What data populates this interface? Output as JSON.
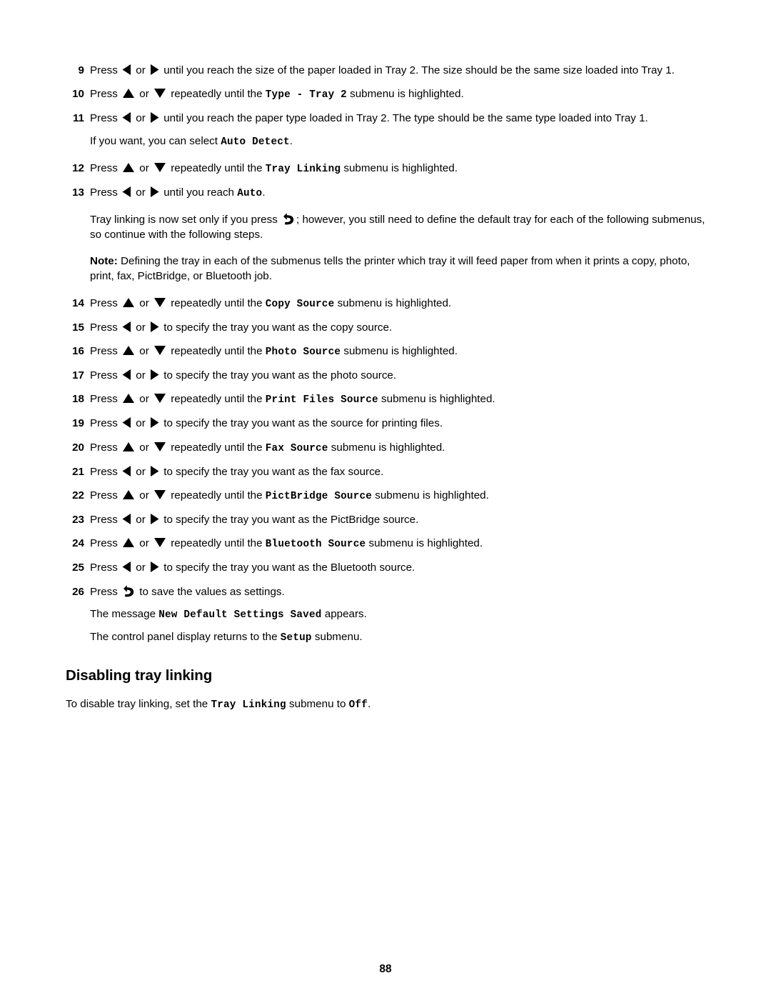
{
  "document": {
    "page_number": "88",
    "heading": "Disabling tray linking",
    "heading_body_before": "To disable tray linking, set the ",
    "heading_body_ui1": "Tray Linking",
    "heading_body_mid": " submenu to ",
    "heading_body_ui2": "Off",
    "heading_body_after": "."
  },
  "icons": {
    "left": "left-arrow-icon",
    "right": "right-arrow-icon",
    "up": "up-arrow-icon",
    "down": "down-arrow-icon",
    "back": "back-arrow-icon",
    "or": " or "
  },
  "steps": [
    {
      "num": "9",
      "p1": "Press ",
      "p2": " until you reach the size of the paper loaded in Tray 2. The size should be the same size loaded into Tray 1."
    },
    {
      "num": "10",
      "p1": "Press ",
      "p2": " repeatedly until the ",
      "ui": "Type - Tray 2",
      "p3": " submenu is highlighted."
    },
    {
      "num": "11",
      "p1": "Press ",
      "p2": " until you reach the paper type loaded in Tray 2. The type should be the same type loaded into Tray 1."
    },
    {
      "num": "12",
      "p1": "Press ",
      "p2": " repeatedly until the ",
      "ui": "Tray Linking",
      "p3": " submenu is highlighted."
    },
    {
      "num": "13",
      "p1": "Press ",
      "p2": " until you reach ",
      "ui": "Auto",
      "p3": "."
    },
    {
      "num": "14",
      "p1": "Press ",
      "p2": " repeatedly until the ",
      "ui": "Copy Source",
      "p3": " submenu is highlighted."
    },
    {
      "num": "15",
      "p1": "Press ",
      "p2": " to specify the tray you want as the copy source."
    },
    {
      "num": "16",
      "p1": "Press ",
      "p2": " repeatedly until the ",
      "ui": "Photo Source",
      "p3": " submenu is highlighted."
    },
    {
      "num": "17",
      "p1": "Press ",
      "p2": " to specify the tray you want as the photo source."
    },
    {
      "num": "18",
      "p1": "Press ",
      "p2": " repeatedly until the ",
      "ui": "Print Files Source",
      "p3": " submenu is highlighted."
    },
    {
      "num": "19",
      "p1": "Press ",
      "p2": " to specify the tray you want as the source for printing files."
    },
    {
      "num": "20",
      "p1": "Press ",
      "p2": " repeatedly until the ",
      "ui": "Fax Source",
      "p3": " submenu is highlighted."
    },
    {
      "num": "21",
      "p1": "Press ",
      "p2": " to specify the tray you want as the fax source."
    },
    {
      "num": "22",
      "p1": "Press ",
      "p2": " repeatedly until the ",
      "ui": "PictBridge Source",
      "p3": " submenu is highlighted."
    },
    {
      "num": "23",
      "p1": "Press ",
      "p2": " to specify the tray you want as the PictBridge source."
    },
    {
      "num": "24",
      "p1": "Press ",
      "p2": " repeatedly until the ",
      "ui": "Bluetooth Source",
      "p3": " submenu is highlighted."
    },
    {
      "num": "25",
      "p1": "Press ",
      "p2": " to specify the tray you want as the Bluetooth source."
    },
    {
      "num": "26",
      "p1": "Press ",
      "p2": " to save the values as settings."
    }
  ],
  "paragraphs": {
    "auto_detect_before": "If you want, you can select ",
    "auto_detect_ui": "Auto Detect",
    "auto_detect_after": ".",
    "tray_linking_before": "Tray linking is now set only if you press ",
    "tray_linking_after": "; however, you still need to define the default tray for each of the following submenus, so continue with the following steps.",
    "note_label": "Note:",
    "note_text": " Defining the tray in each of the submenus tells the printer which tray it will feed paper from when it prints a copy, photo, print, fax, PictBridge, or Bluetooth job.",
    "message_before": "The message ",
    "message_ui": "New Default Settings Saved",
    "message_after": " appears.",
    "control_panel_before": "The control panel display returns to the ",
    "control_panel_ui": "Setup",
    "control_panel_after": " submenu."
  }
}
